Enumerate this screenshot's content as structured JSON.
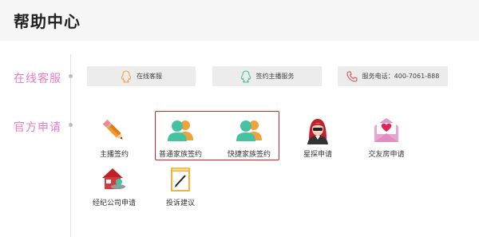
{
  "header": {
    "title": "帮助中心"
  },
  "sections": {
    "online": {
      "label": "在线客服"
    },
    "official": {
      "label": "官方申请"
    }
  },
  "services": [
    {
      "label": "在线客服",
      "icon": "qq-penguin-icon"
    },
    {
      "label": "签约主播服务",
      "icon": "qq-penguin-icon"
    },
    {
      "label": "服务电话：400-7061-888",
      "icon": "phone-icon"
    }
  ],
  "apps": [
    {
      "label": "主播签约",
      "icon": "pencil-icon"
    },
    {
      "label": "普通家族签约",
      "icon": "family-users-icon"
    },
    {
      "label": "快捷家族签约",
      "icon": "family-users-icon"
    },
    {
      "label": "星探申请",
      "icon": "scout-avatar-icon"
    },
    {
      "label": "交友房申请",
      "icon": "heart-envelope-icon"
    },
    {
      "label": "经纪公司申请",
      "icon": "agency-house-icon"
    },
    {
      "label": "投诉建议",
      "icon": "complaint-board-icon"
    }
  ],
  "colors": {
    "accent_pink": "#e57ec6",
    "highlight_red": "#d9252a"
  }
}
